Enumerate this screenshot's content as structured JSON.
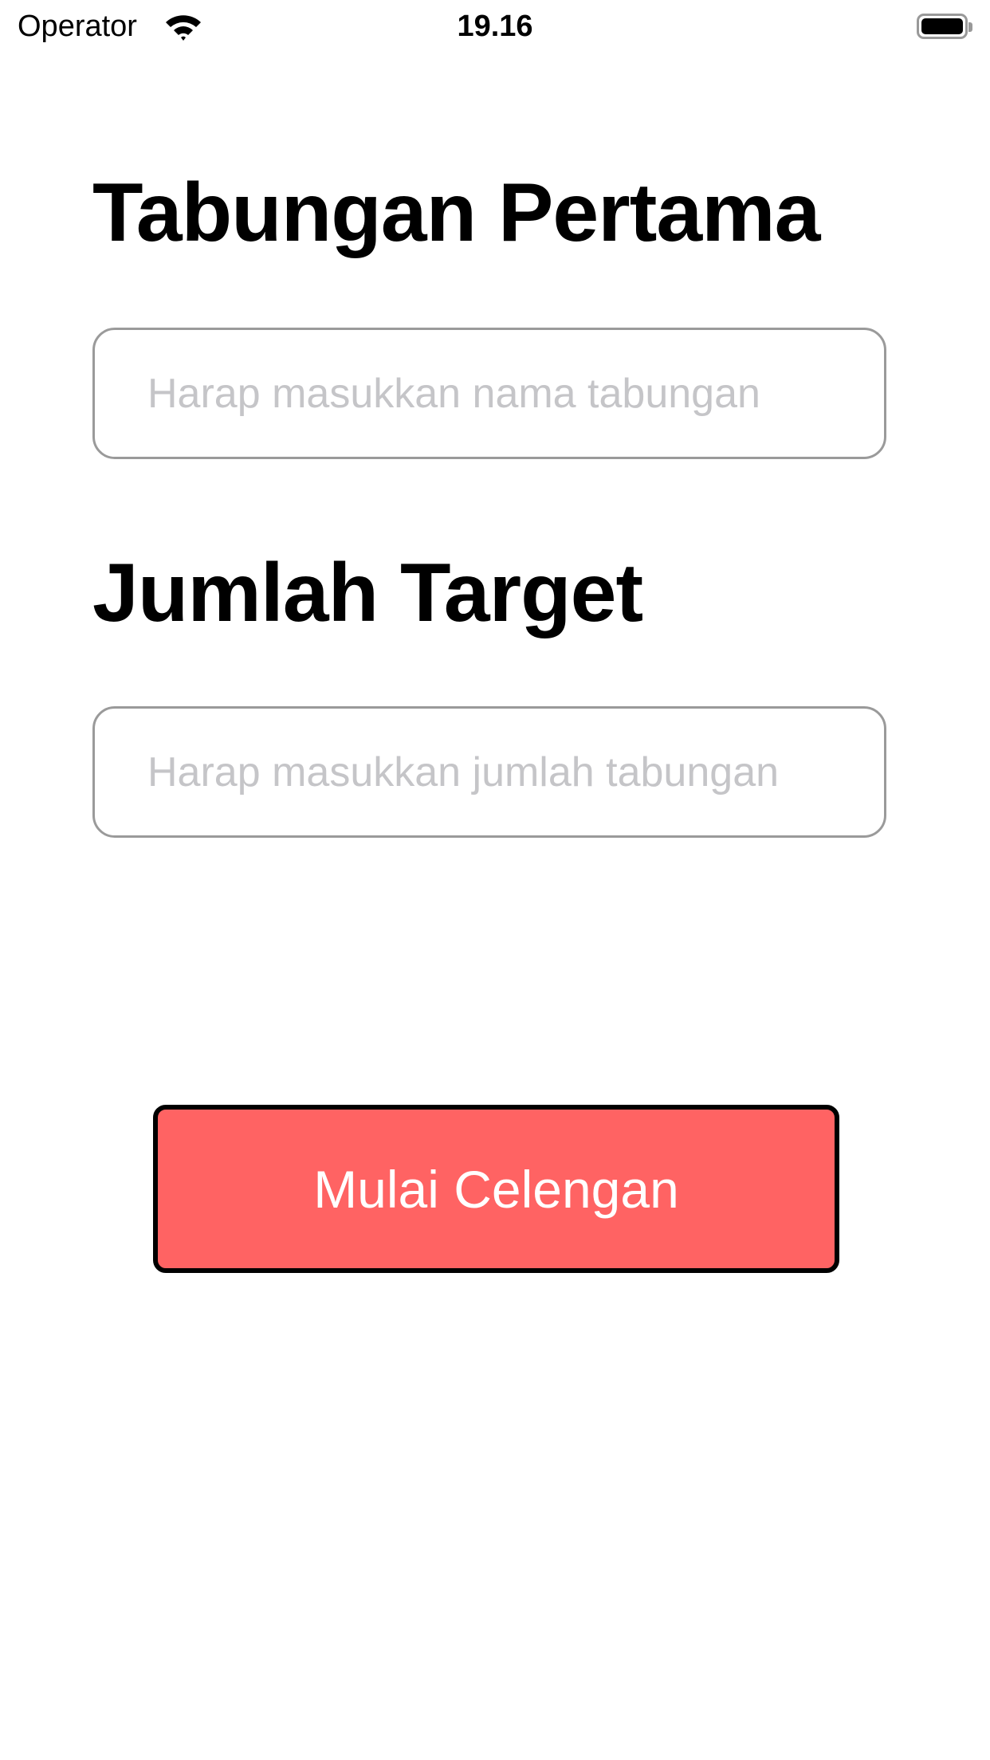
{
  "status_bar": {
    "carrier": "Operator",
    "time": "19.16",
    "wifi_icon": "wifi-icon",
    "battery_icon": "battery-icon"
  },
  "form": {
    "name_heading": "Tabungan Pertama",
    "name_placeholder": "Harap masukkan nama tabungan",
    "name_value": "",
    "target_heading": "Jumlah Target",
    "target_placeholder": "Harap masukkan jumlah tabungan",
    "target_value": ""
  },
  "actions": {
    "start_label": "Mulai Celengan"
  },
  "colors": {
    "button_bg": "#ff6363",
    "button_border": "#000000",
    "field_border": "#9a9a9a",
    "placeholder": "#c5c5c8"
  }
}
